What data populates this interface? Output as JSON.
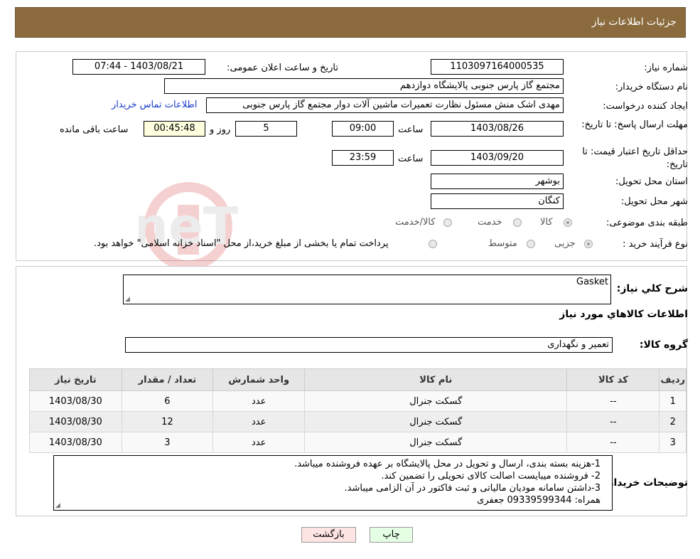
{
  "header": {
    "title": "جزئیات اطلاعات نیاز"
  },
  "info": {
    "need_number_label": "شماره نیاز:",
    "need_number": "1103097164000535",
    "announce_label": "تاریخ و ساعت اعلان عمومی:",
    "announce_value": "1403/08/21 - 07:44",
    "buyer_label": "نام دستگاه خریدار:",
    "buyer_value": "مجتمع گاز پارس جنوبی  پالایشگاه دوازدهم",
    "creator_label": "ایجاد کننده درخواست:",
    "creator_value": "مهدی اشک منش مسئول نظارت تعمیرات ماشین آلات دوار مجتمع گاز پارس جنوبی",
    "contact_link": "اطلاعات تماس خریدار",
    "deadline_label": "مهلت ارسال پاسخ: تا تاریخ:",
    "deadline_date": "1403/08/26",
    "time_label": "ساعت",
    "deadline_time": "09:00",
    "days_value": "5",
    "days_label": "روز و",
    "remaining_time": "00:45:48",
    "remaining_label": "ساعت باقی مانده",
    "validity_label": "حداقل تاریخ اعتبار قیمت: تا تاریخ:",
    "validity_date": "1403/09/20",
    "validity_time": "23:59",
    "province_label": "استان محل تحویل:",
    "province_value": "بوشهر",
    "city_label": "شهر محل تحویل:",
    "city_value": "کنگان",
    "category_label": "طبقه بندی موضوعی:",
    "category_options": [
      "کالا",
      "خدمت",
      "کالا/خدمت"
    ],
    "purchase_label": "نوع فرآیند خرید :",
    "purchase_options": [
      "جزیی",
      "متوسط"
    ],
    "purchase_note": "پرداخت تمام یا بخشی از مبلغ خرید،از محل \"اسناد خزانه اسلامی\" خواهد بود."
  },
  "details": {
    "summary_label": "شرح کلي نياز:",
    "summary_value": "Gasket",
    "goods_info_title": "اطلاعات کالاهاي مورد نياز",
    "group_label": "گروه کالا:",
    "group_value": "تعمیر و نگهداری",
    "table": {
      "headers": [
        "رديف",
        "کد کالا",
        "نام کالا",
        "واحد شمارش",
        "تعداد / مقدار",
        "تاریخ نیاز"
      ],
      "rows": [
        [
          "1",
          "--",
          "گسکت جنرال",
          "عدد",
          "6",
          "1403/08/30"
        ],
        [
          "2",
          "--",
          "گسکت جنرال",
          "عدد",
          "12",
          "1403/08/30"
        ],
        [
          "3",
          "--",
          "گسکت جنرال",
          "عدد",
          "3",
          "1403/08/30"
        ]
      ]
    },
    "buyer_notes_label": "توضیحات خریدار:",
    "buyer_notes": [
      "1-هزینه بسته بندی، ارسال و تحویل در محل پالایشگاه بر عهده فروشنده میباشد.",
      "2- فروشنده میبایست اصالت کالای تحویلی را تضمین کند.",
      "3-داشتن سامانه مودیان مالیاتی و ثبت فاکتور در آن الزامی میباشد.",
      "همراه: 09339599344 جعفری"
    ]
  },
  "buttons": {
    "print": "چاپ",
    "back": "بازگشت"
  },
  "watermark": {
    "text": "AriaTender.neT"
  },
  "colors": {
    "header_bg": "#8b6b3e",
    "back_button_bg": "#ffe4e4",
    "print_button_bg": "#e4ffe4",
    "link": "#1a3ccc"
  }
}
